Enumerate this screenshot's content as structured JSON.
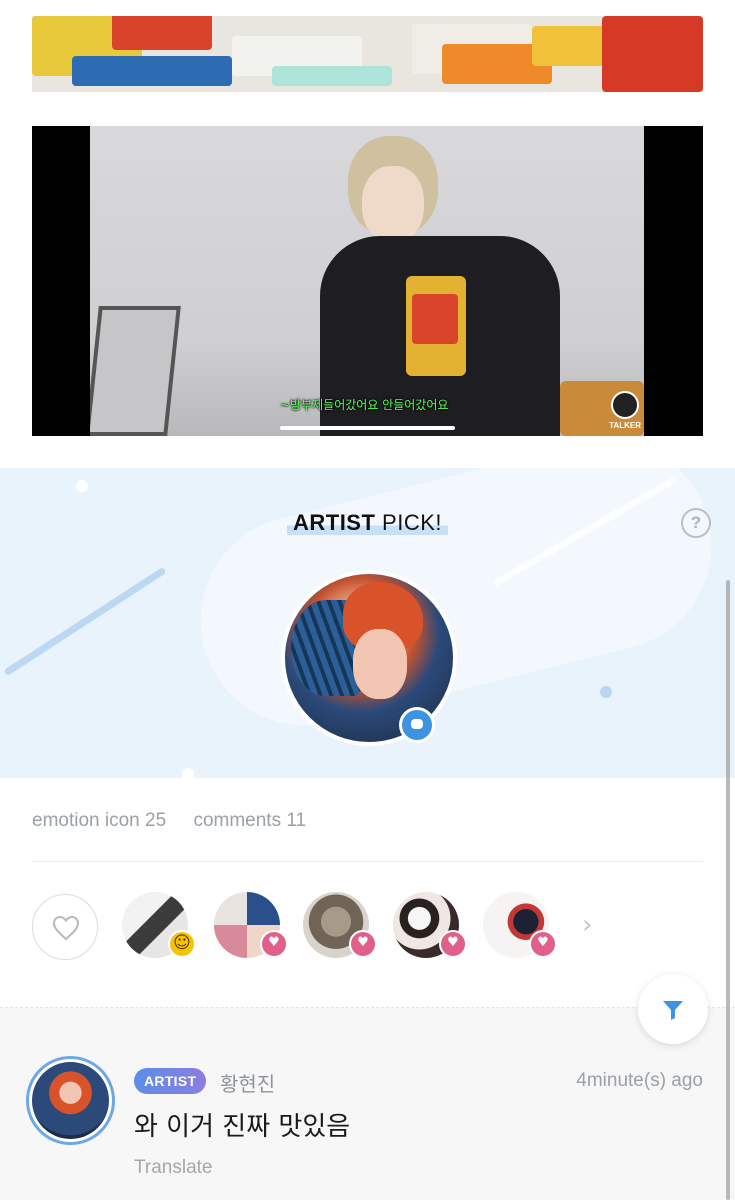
{
  "video": {
    "subtitle": "~방부제들어갔어요 안들어갔어요",
    "watermark": "TALKER"
  },
  "artist_pick": {
    "title_bold": "ARTIST",
    "title_rest": " PICK!",
    "help_icon": "question-circle-icon",
    "badge_icon": "comment-bubble-icon"
  },
  "stats": {
    "emotion": "emotion icon 25",
    "comments": "comments 11"
  },
  "reactions": {
    "items": [
      {
        "emotion": "laugh"
      },
      {
        "emotion": "heart"
      },
      {
        "emotion": "heart"
      },
      {
        "emotion": "heart"
      },
      {
        "emotion": "heart"
      }
    ],
    "more_icon": "chevron-right-icon"
  },
  "comment": {
    "badge": "ARTIST",
    "name": "황현진",
    "time": "4minute(s) ago",
    "text": "와 이거 진짜 맛있음",
    "translate": "Translate"
  },
  "colors": {
    "accent_blue": "#3d93e0",
    "heart_pink": "#e0608a",
    "pick_bg": "#e9f3fc"
  }
}
